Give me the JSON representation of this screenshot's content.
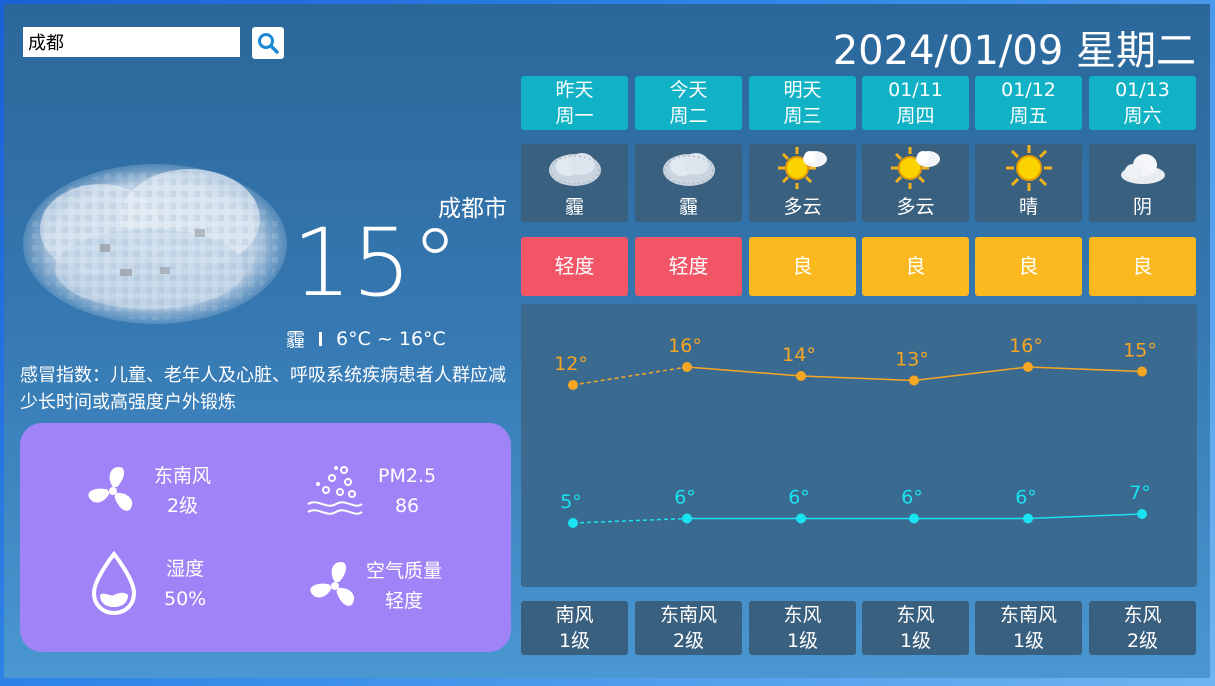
{
  "search": {
    "value": "成都"
  },
  "header": {
    "date": "2024/01/09 星期二"
  },
  "current": {
    "city": "成都市",
    "temp": "15°",
    "condition": "霾",
    "range": "6°C ~ 16°C",
    "cold_index": "感冒指数：儿童、老年人及心脏、呼吸系统疾病患者人群应减少长时间或高强度户外锻炼"
  },
  "details": {
    "wind_dir": "东南风",
    "wind_level": "2级",
    "pm_label": "PM2.5",
    "pm_value": "86",
    "humidity_label": "湿度",
    "humidity_value": "50%",
    "aqi_label": "空气质量",
    "aqi_value": "轻度"
  },
  "days": [
    {
      "name": "昨天",
      "week": "周一",
      "weather": "霾",
      "icon": "haze-icon",
      "aq": "轻度",
      "aq_color": "#f25565",
      "wind_dir": "南风",
      "wind_level": "1级"
    },
    {
      "name": "今天",
      "week": "周二",
      "weather": "霾",
      "icon": "haze-icon",
      "aq": "轻度",
      "aq_color": "#f25565",
      "wind_dir": "东南风",
      "wind_level": "2级"
    },
    {
      "name": "明天",
      "week": "周三",
      "weather": "多云",
      "icon": "partly-cloudy-icon",
      "aq": "良",
      "aq_color": "#fbb81f",
      "wind_dir": "东风",
      "wind_level": "1级"
    },
    {
      "name": "01/11",
      "week": "周四",
      "weather": "多云",
      "icon": "partly-cloudy-icon",
      "aq": "良",
      "aq_color": "#fbb81f",
      "wind_dir": "东风",
      "wind_level": "1级"
    },
    {
      "name": "01/12",
      "week": "周五",
      "weather": "晴",
      "icon": "sun-icon",
      "aq": "良",
      "aq_color": "#fbb81f",
      "wind_dir": "东南风",
      "wind_level": "1级"
    },
    {
      "name": "01/13",
      "week": "周六",
      "weather": "阴",
      "icon": "overcast-icon",
      "aq": "良",
      "aq_color": "#fbb81f",
      "wind_dir": "东风",
      "wind_level": "2级"
    }
  ],
  "chart_data": {
    "type": "line",
    "categories": [
      "昨天",
      "今天",
      "明天",
      "01/11",
      "01/12",
      "01/13"
    ],
    "series": [
      {
        "values": [
          12,
          16,
          14,
          13,
          16,
          15
        ],
        "color": "#f5a623"
      },
      {
        "values": [
          5,
          6,
          6,
          6,
          6,
          7
        ],
        "color": "#19e3f0"
      }
    ],
    "value_suffix": "°",
    "first_segment_dashed": true
  }
}
